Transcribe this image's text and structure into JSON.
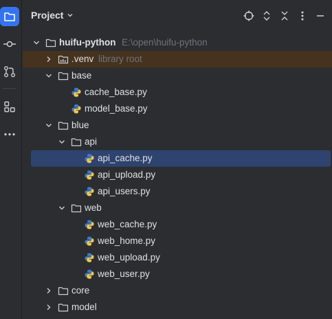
{
  "panel": {
    "title": "Project"
  },
  "toolbar": {
    "icons": [
      "locate-icon",
      "expand-icon",
      "collapse-icon",
      "more-options-icon",
      "minimize-icon"
    ]
  },
  "activity_bar": {
    "items": [
      "project-icon",
      "commit-icon",
      "pull-requests-icon",
      "structure-icon",
      "more-icon"
    ]
  },
  "tree": {
    "root": {
      "label": "huifu-python",
      "path": "E:\\open\\huifu-python"
    },
    "venv": {
      "label": ".venv",
      "note": "library root"
    },
    "base": {
      "label": "base"
    },
    "cache_base": {
      "label": "cache_base.py"
    },
    "model_base": {
      "label": "model_base.py"
    },
    "blue": {
      "label": "blue"
    },
    "api": {
      "label": "api"
    },
    "api_cache": {
      "label": "api_cache.py"
    },
    "api_upload": {
      "label": "api_upload.py"
    },
    "api_users": {
      "label": "api_users.py"
    },
    "web": {
      "label": "web"
    },
    "web_cache": {
      "label": "web_cache.py"
    },
    "web_home": {
      "label": "web_home.py"
    },
    "web_upload": {
      "label": "web_upload.py"
    },
    "web_user": {
      "label": "web_user.py"
    },
    "core": {
      "label": "core"
    },
    "model": {
      "label": "model"
    }
  },
  "colors": {
    "selection": "#2e436e",
    "library_root_row": "#45331f",
    "accent": "#3574f0",
    "python_blue": "#3f7cc8",
    "python_yellow": "#f2c94c"
  }
}
